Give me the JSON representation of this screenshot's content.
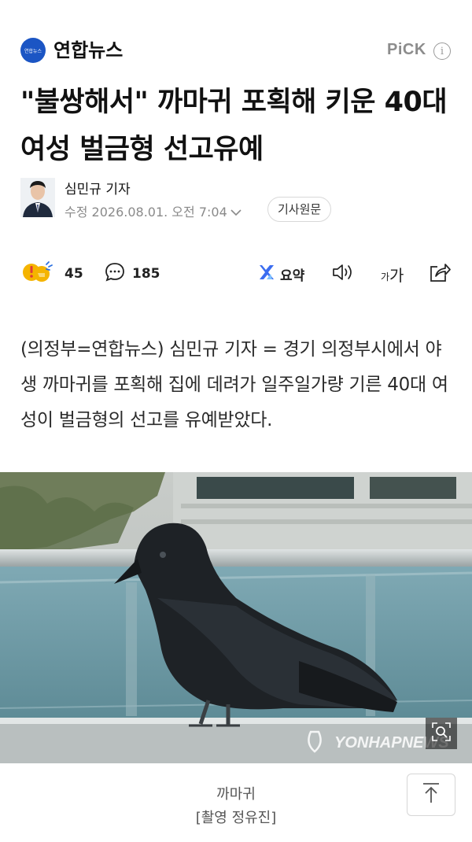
{
  "header": {
    "press_logo_text": "연합뉴스",
    "press_name": "연합뉴스",
    "pick_label": "PiCK",
    "info_icon": "info-circle-icon"
  },
  "article": {
    "headline": "\"불쌍해서\" 까마귀 포획해 키운 40대 여성 벌금형 선고유예",
    "reporter": "심민규 기자",
    "date": "수정 2026.08.01. 오전 7:04",
    "original_button": "기사원문",
    "lead": "(의정부=연합뉴스) 심민규 기자 = 경기 의정부시에서 야생 까마귀를 포획해 집에 데려가 일주일가량 기른 40대 여성이 벌금형의 선고를 유예받았다."
  },
  "actions": {
    "reaction_count": "45",
    "comment_count": "185",
    "summary_label": "요약",
    "font_small": "가",
    "font_large": "가"
  },
  "photo": {
    "watermark": "YONHAPNEWS",
    "caption_title": "까마귀",
    "caption_credit": "[촬영 정유진]"
  },
  "colors": {
    "brand_blue": "#1b55c4",
    "summary_accent": "#3b6df0",
    "muted_text": "#8a8a8a"
  }
}
